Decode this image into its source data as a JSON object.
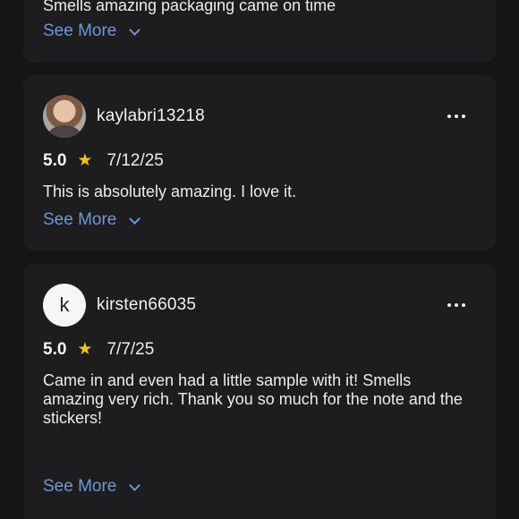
{
  "reviews": [
    {
      "text": "Smells amazing packaging came on time",
      "see_more": "See More",
      "icon": "chevron-down-icon"
    },
    {
      "username": "kaylabri13218",
      "avatar": "profile-photo",
      "rating": "5.0",
      "date": "7/12/25",
      "text": "This is absolutely amazing. I love it.",
      "see_more": "See More",
      "more_icon": "more-horizontal-icon",
      "star_icon": "star-icon"
    },
    {
      "username": "kirsten66035",
      "avatar_letter": "k",
      "rating": "5.0",
      "date": "7/7/25",
      "text": "Came in and even had a little sample with it! Smells amazing very rich. Thank you so much for the note and the stickers!",
      "see_more": "See More",
      "more_icon": "more-horizontal-icon",
      "star_icon": "star-icon"
    }
  ],
  "colors": {
    "background": "#151515",
    "card": "#1d1d1f",
    "link": "#6f96d6",
    "star": "#f1c40f"
  }
}
